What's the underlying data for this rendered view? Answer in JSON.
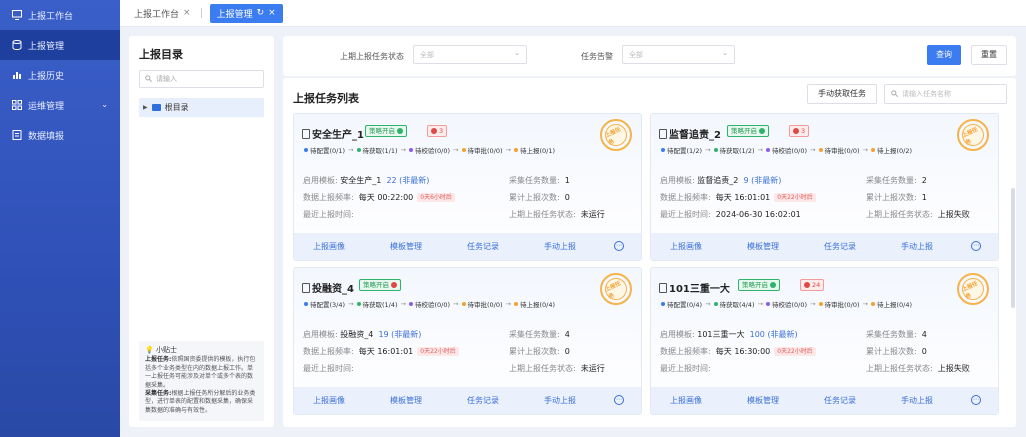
{
  "sidebar": {
    "items": [
      {
        "label": "上报工作台",
        "icon": "monitor-icon"
      },
      {
        "label": "上报管理",
        "icon": "database-icon",
        "active": true
      },
      {
        "label": "上报历史",
        "icon": "bar-chart-icon"
      },
      {
        "label": "运维管理",
        "icon": "grid-icon"
      },
      {
        "label": "数据填报",
        "icon": "form-icon"
      }
    ]
  },
  "tabs": [
    {
      "label": "上报工作台",
      "close": "×"
    },
    {
      "label": "上报管理",
      "refresh": "↻",
      "close": "×"
    }
  ],
  "catalog": {
    "title": "上报目录",
    "search_placeholder": "请输入",
    "root_node": "根目录"
  },
  "tip": {
    "title": "小贴士",
    "task_term": "上报任务:",
    "task_text": "依照国资委提供的模板，执行包括多个业务类型在内的数据上报工作。单一上报任务可能涉及对单个或多个表的数据采集。",
    "collect_term": "采集任务:",
    "collect_text": "根据上报任务所分解后的业务类型，进行单表的配置和数据采集，确保采集数据的准确与有效性。"
  },
  "filters": {
    "status_label": "上期上报任务状态",
    "status_value": "全部",
    "alert_label": "任务告警",
    "alert_value": "全部",
    "query_button": "查询",
    "reset_button": "重置"
  },
  "task_list": {
    "title": "上报任务列表",
    "fetch_button": "手动获取任务",
    "search_placeholder": "请输入任务名称",
    "field_labels": {
      "template": "启用模板:",
      "collect_count": "采集任务数量:",
      "frequency": "数据上报频率:",
      "report_count": "累计上报次数:",
      "last_time": "最近上报时间:",
      "last_status": "上期上报任务状态:"
    },
    "ops": {
      "portrait": "上报画像",
      "template_mgmt": "模板管理",
      "records": "任务记录",
      "manual": "手动上报",
      "more": "⋯"
    },
    "cards": [
      {
        "name": "安全生产_1",
        "policy": "策略开启",
        "alarm": "3",
        "stamp": "上报任务",
        "steps": [
          "待配置(0/1)",
          "待获取(1/1)",
          "待校验(0/0)",
          "待审批(0/0)",
          "待上报(0/1)"
        ],
        "template": "安全生产_1",
        "version": "22 (非最新)",
        "collect_count": "1",
        "frequency": "每天 00:22:00",
        "freq_warn": "0天6小时后",
        "report_count": "0",
        "last_time": "",
        "last_status": "未运行"
      },
      {
        "name": "监督追责_2",
        "policy": "策略开启",
        "alarm": "3",
        "stamp": "上报任务",
        "steps": [
          "待配置(1/2)",
          "待获取(1/2)",
          "待校验(0/0)",
          "待审批(0/0)",
          "待上报(0/2)"
        ],
        "template": "监督追责_2",
        "version": "9 (非最新)",
        "collect_count": "2",
        "frequency": "每天 16:01:01",
        "freq_warn": "0天22小时后",
        "report_count": "1",
        "last_time": "2024-06-30 16:02:01",
        "last_status": "上报失败"
      },
      {
        "name": "投融资_4",
        "policy": "策略开启",
        "alarm": "",
        "stamp": "上报任务",
        "steps": [
          "待配置(3/4)",
          "待获取(1/4)",
          "待校验(0/0)",
          "待审批(0/0)",
          "待上报(0/4)"
        ],
        "template": "投融资_4",
        "version": "19 (非最新)",
        "collect_count": "4",
        "frequency": "每天 16:01:01",
        "freq_warn": "0天22小时后",
        "report_count": "0",
        "last_time": "",
        "last_status": "未运行"
      },
      {
        "name": "101三重一大",
        "policy": "策略开启",
        "alarm": "24",
        "stamp": "上报任务",
        "steps": [
          "待配置(0/4)",
          "待获取(4/4)",
          "待校验(0/0)",
          "待审批(0/0)",
          "待上报(0/4)"
        ],
        "template": "101三重一大",
        "version": "100 (非最新)",
        "collect_count": "4",
        "frequency": "每天 16:30:00",
        "freq_warn": "0天22小时后",
        "report_count": "0",
        "last_time": "",
        "last_status": "上报失败"
      }
    ]
  },
  "colors": {
    "accent": "#3b7cf0",
    "sidebar": "#2f51b8",
    "success": "#2eb36a",
    "danger": "#e04848",
    "stamp": "#f5b34a"
  }
}
